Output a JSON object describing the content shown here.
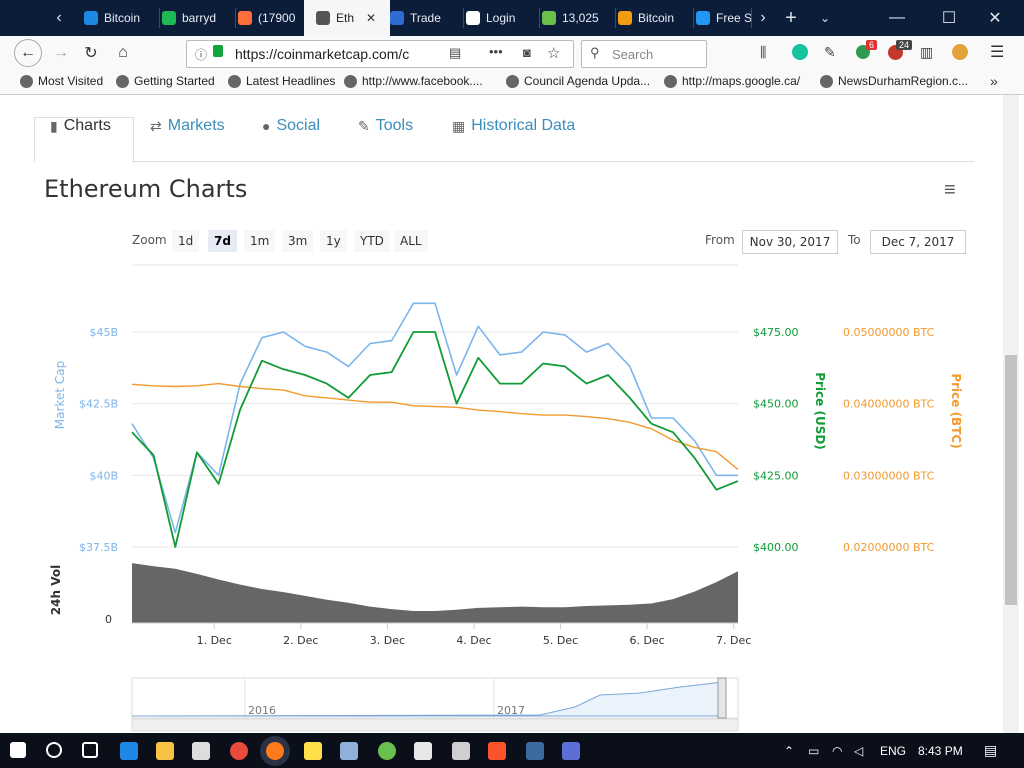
{
  "tabs": [
    {
      "label": "Bitcoin",
      "color": "#1e88e5"
    },
    {
      "label": "barryd",
      "color": "#1db954"
    },
    {
      "label": "(17900",
      "color": "#ff6f3c"
    },
    {
      "label": "Eth",
      "color": "#555555",
      "active": true
    },
    {
      "label": "Trade",
      "color": "#2c6cd3"
    },
    {
      "label": "Login",
      "color": "#ffffff"
    },
    {
      "label": "13,025",
      "color": "#6bc04b"
    },
    {
      "label": "Bitcoin",
      "color": "#f39c12"
    },
    {
      "label": "Free S",
      "color": "#2196f3"
    }
  ],
  "url": "https://coinmarketcap.com/c",
  "search_placeholder": "Search",
  "badges": {
    "ext1": "6",
    "ext2": "24"
  },
  "bookmarks": [
    {
      "label": "Most Visited"
    },
    {
      "label": "Getting Started"
    },
    {
      "label": "Latest Headlines"
    },
    {
      "label": "http://www.facebook...."
    },
    {
      "label": "Council Agenda Upda..."
    },
    {
      "label": "http://maps.google.ca/"
    },
    {
      "label": "NewsDurhamRegion.c..."
    }
  ],
  "page_tabs": [
    {
      "label": "Charts",
      "icon": "bar-chart-icon"
    },
    {
      "label": "Markets",
      "icon": "exchange-icon"
    },
    {
      "label": "Social",
      "icon": "globe-icon"
    },
    {
      "label": "Tools",
      "icon": "wrench-icon"
    },
    {
      "label": "Historical Data",
      "icon": "calendar-icon"
    }
  ],
  "chart_title": "Ethereum Charts",
  "zoom_label": "Zoom",
  "zoom_options": [
    "1d",
    "7d",
    "1m",
    "3m",
    "1y",
    "YTD",
    "ALL"
  ],
  "zoom_selected": "7d",
  "from_label": "From",
  "from_date": "Nov 30, 2017",
  "to_label": "To",
  "to_date": "Dec 7, 2017",
  "colors": {
    "market_cap": "#7cb5ec",
    "price_usd": "#0f9b36",
    "price_btc": "#f29a2e",
    "volume": "#666666"
  },
  "chart_data": {
    "type": "line",
    "left_axis": {
      "label": "Market Cap",
      "ticks": [
        "$37.5B",
        "$40B",
        "$42.5B",
        "$45B"
      ]
    },
    "right_axis_usd": {
      "label": "Price (USD)",
      "ticks": [
        "$400.00",
        "$425.00",
        "$450.00",
        "$475.00"
      ]
    },
    "right_axis_btc": {
      "label": "Price (BTC)",
      "ticks": [
        "0.02000000 BTC",
        "0.03000000 BTC",
        "0.04000000 BTC",
        "0.05000000 BTC"
      ]
    },
    "volume_axis": {
      "label": "24h Vol",
      "ticks": [
        "0"
      ]
    },
    "x_ticks": [
      "1. Dec",
      "2. Dec",
      "3. Dec",
      "4. Dec",
      "5. Dec",
      "6. Dec",
      "7. Dec"
    ],
    "x": [
      0,
      0.25,
      0.5,
      0.75,
      1,
      1.25,
      1.5,
      1.75,
      2,
      2.25,
      2.5,
      2.75,
      3,
      3.25,
      3.5,
      3.75,
      4,
      4.25,
      4.5,
      4.75,
      5,
      5.25,
      5.5,
      5.75,
      6,
      6.25,
      6.5,
      6.75,
      7
    ],
    "series": [
      {
        "name": "Market Cap",
        "unit": "$B",
        "values": [
          41.8,
          40.6,
          38.0,
          40.8,
          40.0,
          43.2,
          44.8,
          45.0,
          44.5,
          44.3,
          43.8,
          44.6,
          44.7,
          46.0,
          46.0,
          43.5,
          45.2,
          44.2,
          44.3,
          45.0,
          44.9,
          44.3,
          44.6,
          43.8,
          42.0,
          42.0,
          41.2,
          40.0,
          40.0
        ]
      },
      {
        "name": "Price (USD)",
        "unit": "USD",
        "values": [
          440,
          432,
          400,
          433,
          422,
          448,
          465,
          462,
          460,
          457,
          452,
          460,
          461,
          475,
          475,
          450,
          466,
          457,
          457,
          464,
          463,
          457,
          460,
          452,
          443,
          440,
          431,
          420,
          423
        ]
      },
      {
        "name": "Price (BTC)",
        "unit": "BTC",
        "values": [
          0.0427,
          0.0425,
          0.0424,
          0.0425,
          0.0428,
          0.0424,
          0.0421,
          0.0419,
          0.0411,
          0.0408,
          0.0405,
          0.0402,
          0.0402,
          0.0397,
          0.0396,
          0.0395,
          0.0391,
          0.0389,
          0.0386,
          0.0384,
          0.0384,
          0.0382,
          0.0379,
          0.0374,
          0.0365,
          0.0349,
          0.0339,
          0.0333,
          0.0308
        ]
      },
      {
        "name": "24h Vol",
        "unit": "relative",
        "values": [
          0.95,
          0.9,
          0.86,
          0.78,
          0.69,
          0.61,
          0.54,
          0.49,
          0.43,
          0.37,
          0.32,
          0.26,
          0.22,
          0.19,
          0.19,
          0.21,
          0.24,
          0.25,
          0.26,
          0.25,
          0.25,
          0.27,
          0.28,
          0.29,
          0.31,
          0.38,
          0.5,
          0.65,
          0.82
        ]
      }
    ],
    "navigator_labels": [
      "2016",
      "2017"
    ]
  },
  "taskbar": {
    "lang": "ENG",
    "time": "8:43 PM"
  }
}
